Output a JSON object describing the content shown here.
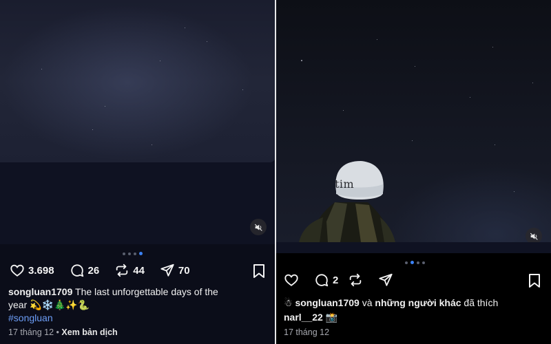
{
  "colors": {
    "accent": "#3b82f6",
    "hashtag": "#6d9ef7",
    "text": "#f5f5f5",
    "muted": "#a7a9b0"
  },
  "left_post": {
    "mute_icon": "speaker-muted-icon",
    "carousel_dots": {
      "count": 4,
      "active_index": 3
    },
    "likes": "3.698",
    "comments": "26",
    "reposts": "44",
    "shares": "70",
    "username": "songluan1709",
    "caption_line1": "The last unforgettable days of the",
    "caption_line2": "year 💫❄️🎄✨🐍",
    "hashtag": "#songluan",
    "date": "17 tháng 12",
    "separator": "•",
    "translate_label": "Xem bản dịch"
  },
  "right_post": {
    "mute_icon": "speaker-muted-icon",
    "carousel_dots": {
      "count": 4,
      "active_index": 1
    },
    "comments": "2",
    "liked_by_icon": "snowman-icon",
    "liked_by_user": "songluan1709",
    "liked_by_rest": " và ",
    "liked_by_others": "những người khác",
    "liked_by_suffix": " đã thích",
    "author": "narl__22",
    "author_emoji": "📸",
    "date": "17 tháng 12",
    "hat_text": "tim"
  }
}
